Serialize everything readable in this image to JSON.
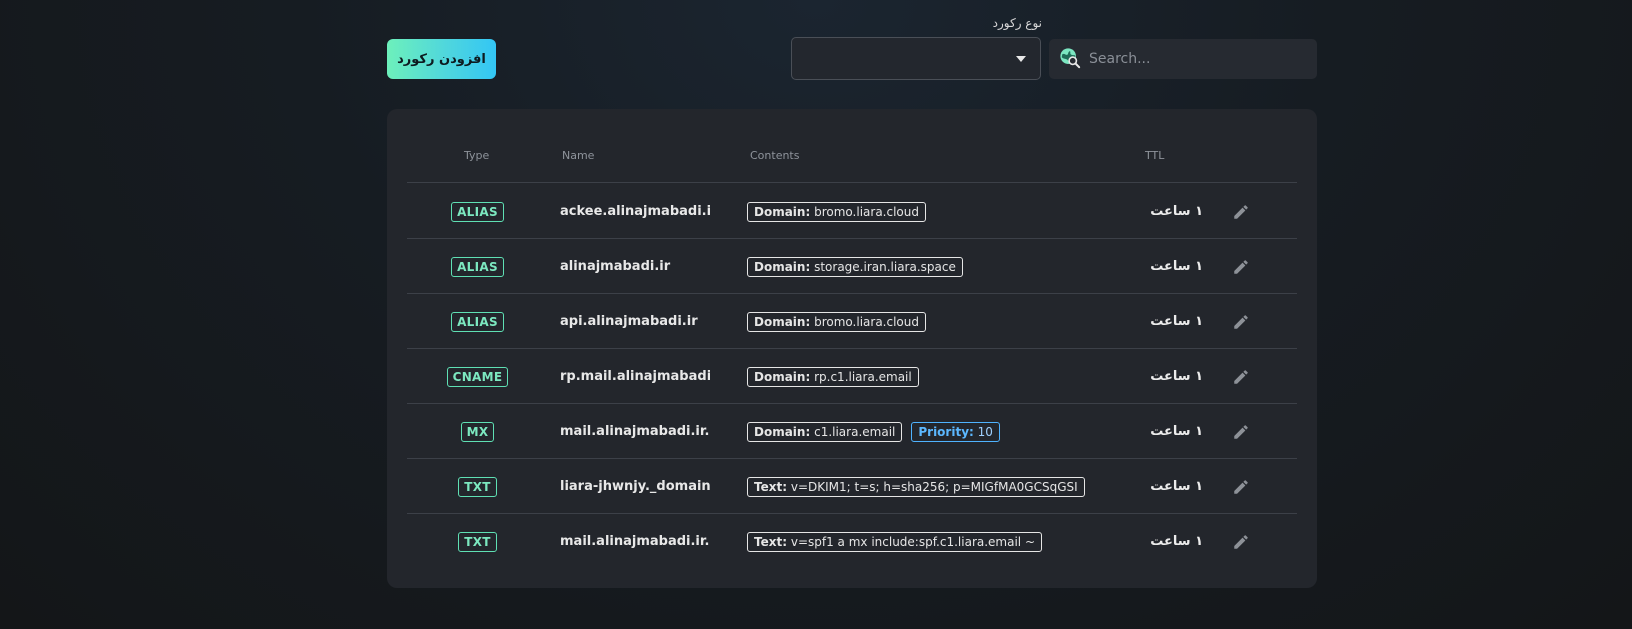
{
  "toolbar": {
    "add_button_label": "افزودن رکورد",
    "record_type_label": "نوع رکورد",
    "record_type_value": "",
    "search_placeholder": "Search..."
  },
  "table": {
    "headers": {
      "type": "Type",
      "name": "Name",
      "contents": "Contents",
      "ttl": "TTL"
    },
    "rows": [
      {
        "type": "ALIAS",
        "name": "ackee.alinajmabadi.i...",
        "contents": [
          {
            "key": "Domain:",
            "value": "bromo.liara.cloud"
          }
        ],
        "ttl": "۱ ساعت"
      },
      {
        "type": "ALIAS",
        "name": "alinajmabadi.ir",
        "contents": [
          {
            "key": "Domain:",
            "value": "storage.iran.liara.space"
          }
        ],
        "ttl": "۱ ساعت"
      },
      {
        "type": "ALIAS",
        "name": "api.alinajmabadi.ir",
        "contents": [
          {
            "key": "Domain:",
            "value": "bromo.liara.cloud"
          }
        ],
        "ttl": "۱ ساعت"
      },
      {
        "type": "CNAME",
        "name": "rp.mail.alinajmabadi...",
        "contents": [
          {
            "key": "Domain:",
            "value": "rp.c1.liara.email"
          }
        ],
        "ttl": "۱ ساعت"
      },
      {
        "type": "MX",
        "name": "mail.alinajmabadi.ir...",
        "contents": [
          {
            "key": "Domain:",
            "value": "c1.liara.email"
          }
        ],
        "priority": {
          "key": "Priority:",
          "value": "10"
        },
        "ttl": "۱ ساعت"
      },
      {
        "type": "TXT",
        "name": "liara-jhwnjy._domain...",
        "contents": [
          {
            "key": "Text:",
            "value": "v=DKIM1; t=s; h=sha256; p=MIGfMA0GCSqGSI"
          }
        ],
        "ttl": "۱ ساعت"
      },
      {
        "type": "TXT",
        "name": "mail.alinajmabadi.ir...",
        "contents": [
          {
            "key": "Text:",
            "value": "v=spf1 a mx include:spf.c1.liara.email ~"
          }
        ],
        "ttl": "۱ ساعت"
      }
    ]
  },
  "icons": {
    "search": "globe-search-icon",
    "edit": "pencil-icon",
    "dropdown": "caret-down-icon"
  },
  "colors": {
    "accent_start": "#6df0bb",
    "accent_end": "#33c6f5",
    "badge": "#7ce8c0",
    "priority": "#5cb8ff"
  }
}
